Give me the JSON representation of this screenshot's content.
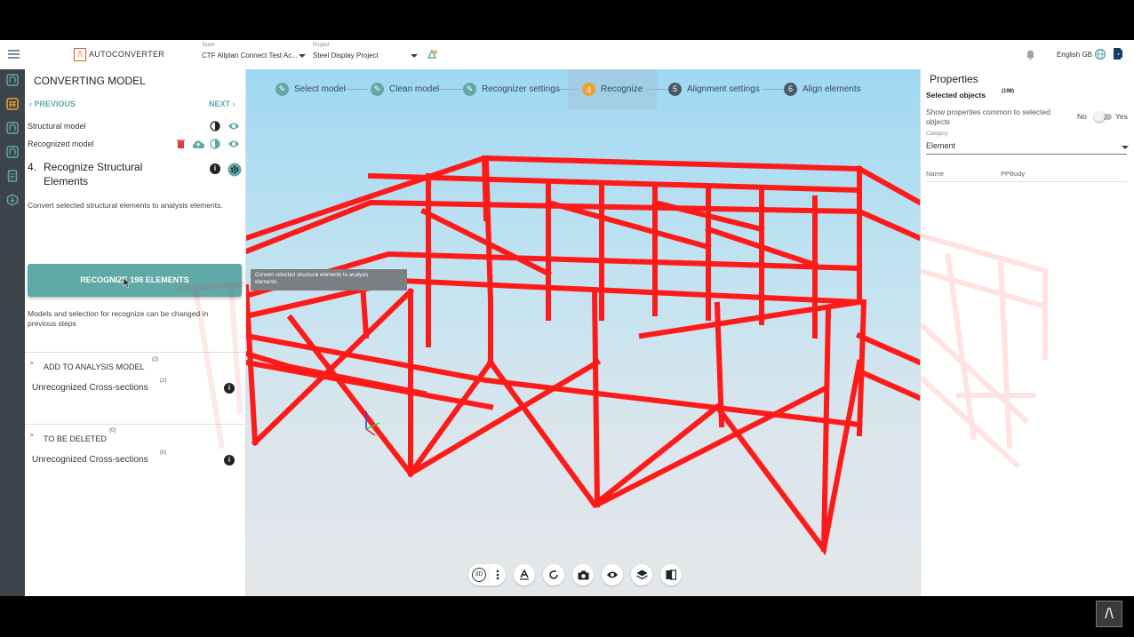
{
  "app": {
    "logo_glyph": "/\\",
    "logo_text": "AUTOCONVERTER"
  },
  "header": {
    "team_label": "Team",
    "team_value": "CTF Allplan Connect Test Ac...",
    "project_label": "Project",
    "project_value": "Steel Display Project",
    "language": "English GB"
  },
  "left_panel": {
    "title": "CONVERTING MODEL",
    "previous": "PREVIOUS",
    "next": "NEXT",
    "structural_model": "Structural model",
    "recognized_model": "Recognized model",
    "step_number": "4.",
    "step_title_line1": "Recognize Structural",
    "step_title_line2": "Elements",
    "description": "Convert selected structural elements to analysis elements.",
    "button_label": "RECOGNIZE 198 ELEMENTS",
    "note_line1": "Models and selection for recognize can be changed in",
    "note_line2": "previous steps",
    "add_section": {
      "title": "ADD TO ANALYSIS MODEL",
      "count": "(2)",
      "item": "Unrecognized Cross-sections",
      "item_count": "(2)"
    },
    "delete_section": {
      "title": "TO BE DELETED",
      "count": "(0)",
      "item": "Unrecognized Cross-sections",
      "item_count": "(0)"
    }
  },
  "stepper": [
    {
      "num": "",
      "label": "Select model",
      "state": "done"
    },
    {
      "num": "",
      "label": "Clean model",
      "state": "done"
    },
    {
      "num": "",
      "label": "Recognizer settings",
      "state": "done"
    },
    {
      "num": "4",
      "label": "Recognize",
      "state": "active"
    },
    {
      "num": "5",
      "label": "Alignment settings",
      "state": "pending"
    },
    {
      "num": "6",
      "label": "Align elements",
      "state": "pending"
    }
  ],
  "tooltip": {
    "line1": "Convert selected structural elements to analysis",
    "line2": "elements."
  },
  "toolbar": {
    "view_3d": "3D"
  },
  "properties": {
    "title": "Properties",
    "selected_label": "Selected objects",
    "selected_count": "(198)",
    "common_line1": "Show properties common to selected",
    "common_line2": "objects",
    "toggle_no": "No",
    "toggle_yes": "Yes",
    "category_label": "Category",
    "category_value": "Element",
    "name_label": "Name",
    "name_value": "PPBody"
  },
  "colors": {
    "accent": "#5fa9a6",
    "active_step": "#f0a030",
    "pending_step": "#4a5a68",
    "steel": "#ff1a1a",
    "rail": "#3d4449"
  },
  "corner_logo": "/\\"
}
